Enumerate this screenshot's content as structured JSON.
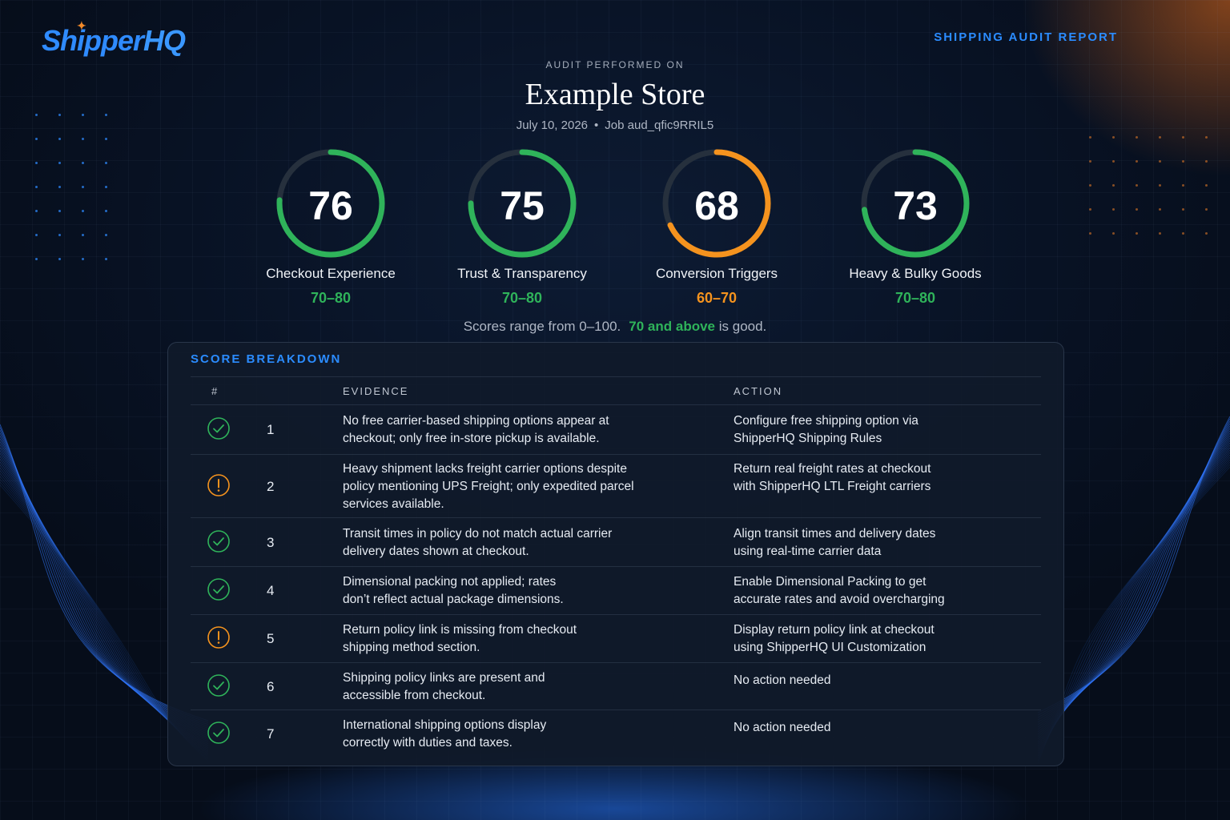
{
  "brand": {
    "logo_main": "Shipper",
    "logo_accent": "HQ",
    "report_label": "SHIPPING AUDIT REPORT"
  },
  "header": {
    "audit_performed_on": "AUDIT PERFORMED ON",
    "store_name": "Example Store",
    "date": "July 10, 2026",
    "job": "Job aud_qfic9RRIL5"
  },
  "colors": {
    "good": "#2fb35a",
    "warning": "#f5931e",
    "accent": "#2b8cff",
    "track": "#26303d"
  },
  "scores": [
    {
      "value": "76",
      "fraction": 0.76,
      "label": "Checkout Experience",
      "range": "70–80",
      "status": "good"
    },
    {
      "value": "75",
      "fraction": 0.75,
      "label": "Trust & Transparency",
      "range": "70–80",
      "status": "good"
    },
    {
      "value": "68",
      "fraction": 0.68,
      "label": "Conversion Triggers",
      "range": "60–70",
      "status": "warning"
    },
    {
      "value": "73",
      "fraction": 0.73,
      "label": "Heavy & Bulky Goods",
      "range": "70–80",
      "status": "good"
    }
  ],
  "legend": {
    "text": "Scores range from 0–100.",
    "good_text": "70 and above",
    "suffix": "is good."
  },
  "breakdown": {
    "title": "SCORE BREAKDOWN",
    "columns": {
      "num": "#",
      "evidence": "EVIDENCE",
      "action": "ACTION"
    },
    "rows": [
      {
        "status": "good",
        "icon": "check-circle-icon",
        "num": "1",
        "evidence": [
          "No free carrier-based shipping options appear at",
          "checkout; only free in-store pickup is available."
        ],
        "action": [
          "Configure free shipping option via",
          "ShipperHQ Shipping Rules"
        ]
      },
      {
        "status": "warning",
        "icon": "alert-circle-icon",
        "num": "2",
        "evidence": [
          "Heavy shipment lacks freight carrier options despite",
          "policy mentioning UPS Freight; only expedited parcel",
          "services available."
        ],
        "action": [
          "Return real freight rates at checkout",
          "with ShipperHQ LTL Freight carriers"
        ]
      },
      {
        "status": "good",
        "icon": "check-circle-icon",
        "num": "3",
        "evidence": [
          "Transit times in policy do not match actual carrier",
          "delivery dates shown at checkout."
        ],
        "action": [
          "Align transit times and delivery dates",
          "using real-time carrier data"
        ]
      },
      {
        "status": "good",
        "icon": "check-circle-icon",
        "num": "4",
        "evidence": [
          "Dimensional packing not applied; rates",
          "don’t reflect actual package dimensions."
        ],
        "action": [
          "Enable Dimensional Packing to get",
          "accurate rates and avoid overcharging"
        ]
      },
      {
        "status": "warning",
        "icon": "alert-circle-icon",
        "num": "5",
        "evidence": [
          "Return policy link is missing from checkout",
          "shipping method section."
        ],
        "action": [
          "Display return policy link at checkout",
          "using ShipperHQ UI Customization"
        ]
      },
      {
        "status": "good",
        "icon": "check-circle-icon",
        "num": "6",
        "evidence": [
          "Shipping policy links are present and",
          "accessible from checkout."
        ],
        "action": [
          "No action needed"
        ]
      },
      {
        "status": "good",
        "icon": "check-circle-icon",
        "num": "7",
        "evidence": [
          "International shipping options display",
          "correctly with duties and taxes."
        ],
        "action": [
          "No action needed"
        ]
      }
    ]
  }
}
